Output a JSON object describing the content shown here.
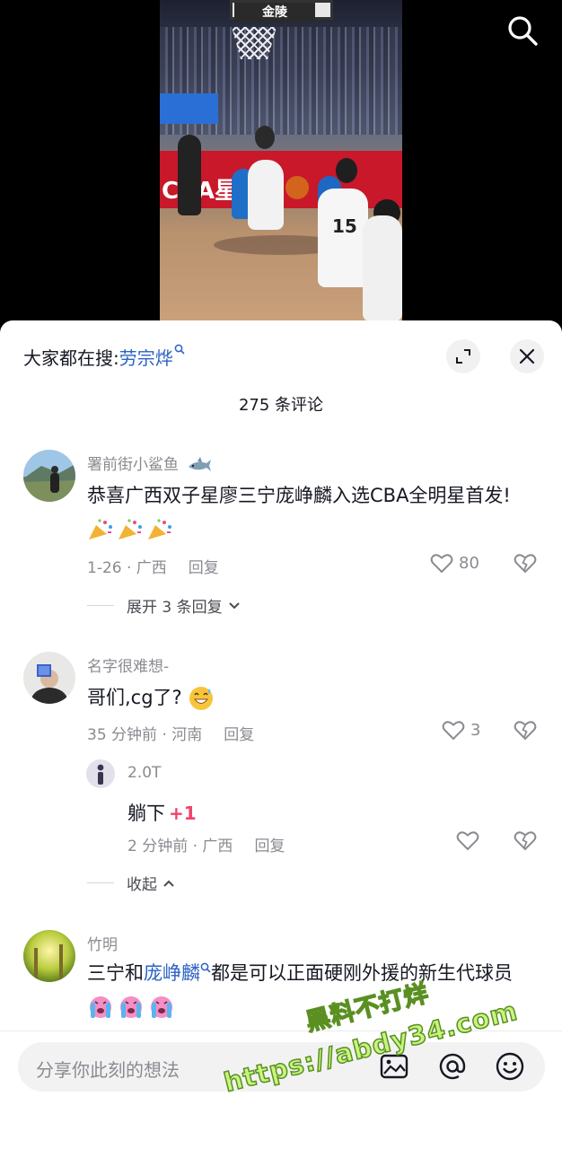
{
  "panel": {
    "trending_prefix": "大家都在搜:",
    "trending_keyword": "劳宗烨",
    "comment_count_title": "275 条评论"
  },
  "comments": [
    {
      "username": "署前街小鲨鱼",
      "username_emoji": "shark-icon",
      "text": "恭喜广西双子星廖三宁庞峥麟入选CBA全明星首发!",
      "emojis": [
        "party-popper-icon",
        "party-popper-icon",
        "party-popper-icon"
      ],
      "meta": "1-26 · 广西",
      "reply_label": "回复",
      "likes": "80",
      "expand_label": "展开 3 条回复"
    },
    {
      "username": "名字很难想-",
      "text": "哥们,cg了?",
      "emojis": [
        "grinning-sweat-icon"
      ],
      "meta": "35 分钟前 · 河南",
      "reply_label": "回复",
      "likes": "3",
      "replies": [
        {
          "username": "2.0T",
          "text": "躺下",
          "badge": "+1",
          "meta": "2 分钟前 · 广西",
          "reply_label": "回复"
        }
      ],
      "collapse_label": "收起"
    },
    {
      "username": "竹明",
      "text_before": "三宁和",
      "text_keyword": "庞峥麟",
      "text_after": "都是可以正面硬刚外援的新生代球员",
      "emojis": [
        "crying-icon",
        "crying-icon",
        "crying-icon"
      ]
    }
  ],
  "video": {
    "sponsor_text": "金陵",
    "ad_text": "CBA星",
    "jersey_number": "15"
  },
  "input_bar": {
    "placeholder": "分享你此刻的想法",
    "icons": [
      "image-icon",
      "at-icon",
      "emoji-icon"
    ]
  },
  "watermark": {
    "line1": "黑料不打烊",
    "line2": "https://abdy34.com"
  },
  "colors": {
    "keyword_blue": "#2c63c3",
    "meta_gray": "#8a8b91",
    "plus_one_pink": "#f0426a",
    "watermark_green": "#c7f57f"
  }
}
